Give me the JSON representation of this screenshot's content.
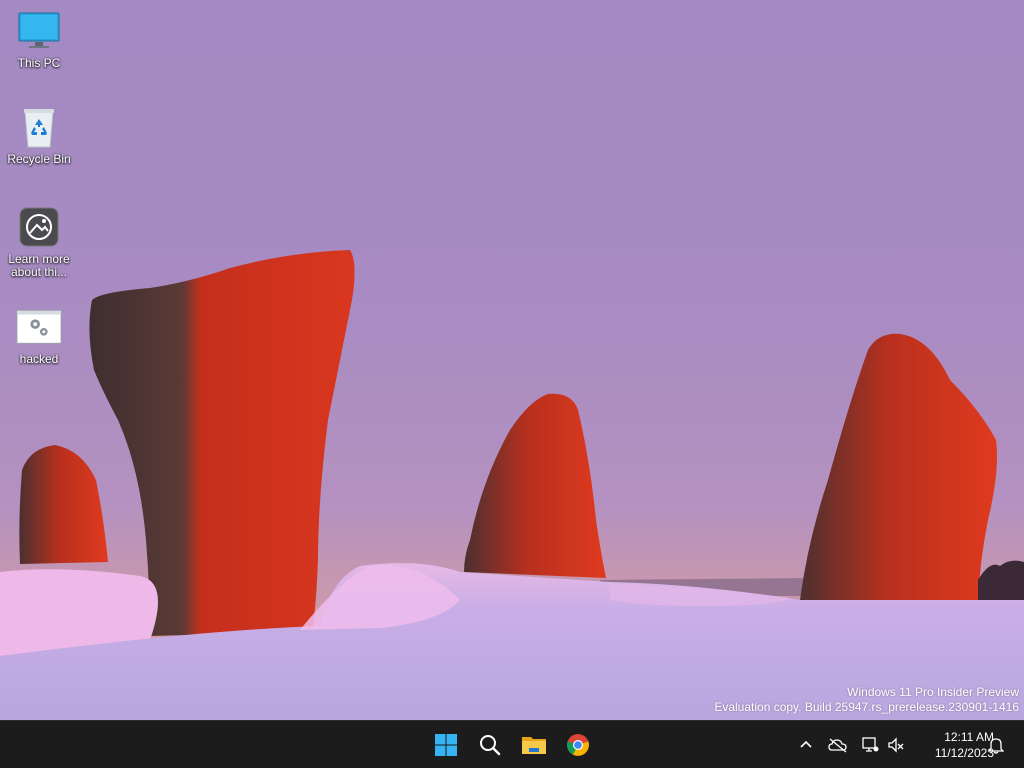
{
  "desktop": {
    "icons": [
      {
        "label": "This PC",
        "icon": "monitor-icon"
      },
      {
        "label": "Recycle Bin",
        "icon": "recycle-bin-icon"
      },
      {
        "label": "Learn more about thi...",
        "icon": "learn-more-icon"
      },
      {
        "label": "hacked",
        "icon": "settings-file-icon"
      }
    ],
    "watermark": {
      "line1": "Windows 11 Pro Insider Preview",
      "line2": "Evaluation copy. Build 25947.rs_prerelease.230901-1416"
    }
  },
  "taskbar": {
    "apps": [
      {
        "name": "Start",
        "icon": "windows-start-icon"
      },
      {
        "name": "Search",
        "icon": "search-icon"
      },
      {
        "name": "File Explorer",
        "icon": "file-explorer-icon"
      },
      {
        "name": "Google Chrome",
        "icon": "chrome-icon"
      }
    ],
    "tray": {
      "icons": [
        "chevron-up-icon",
        "onedrive-offline-icon",
        "network-icon",
        "volume-muted-icon",
        "notification-bell-icon"
      ],
      "time": "12:11 AM",
      "date": "11/12/2023"
    }
  },
  "colors": {
    "taskbar_bg": "#1c1c1c",
    "sky_top": "#a48ac2",
    "horizon_glow": "#e0a096",
    "snow": "#c4b4e4",
    "stone_red": "#e0361e"
  }
}
